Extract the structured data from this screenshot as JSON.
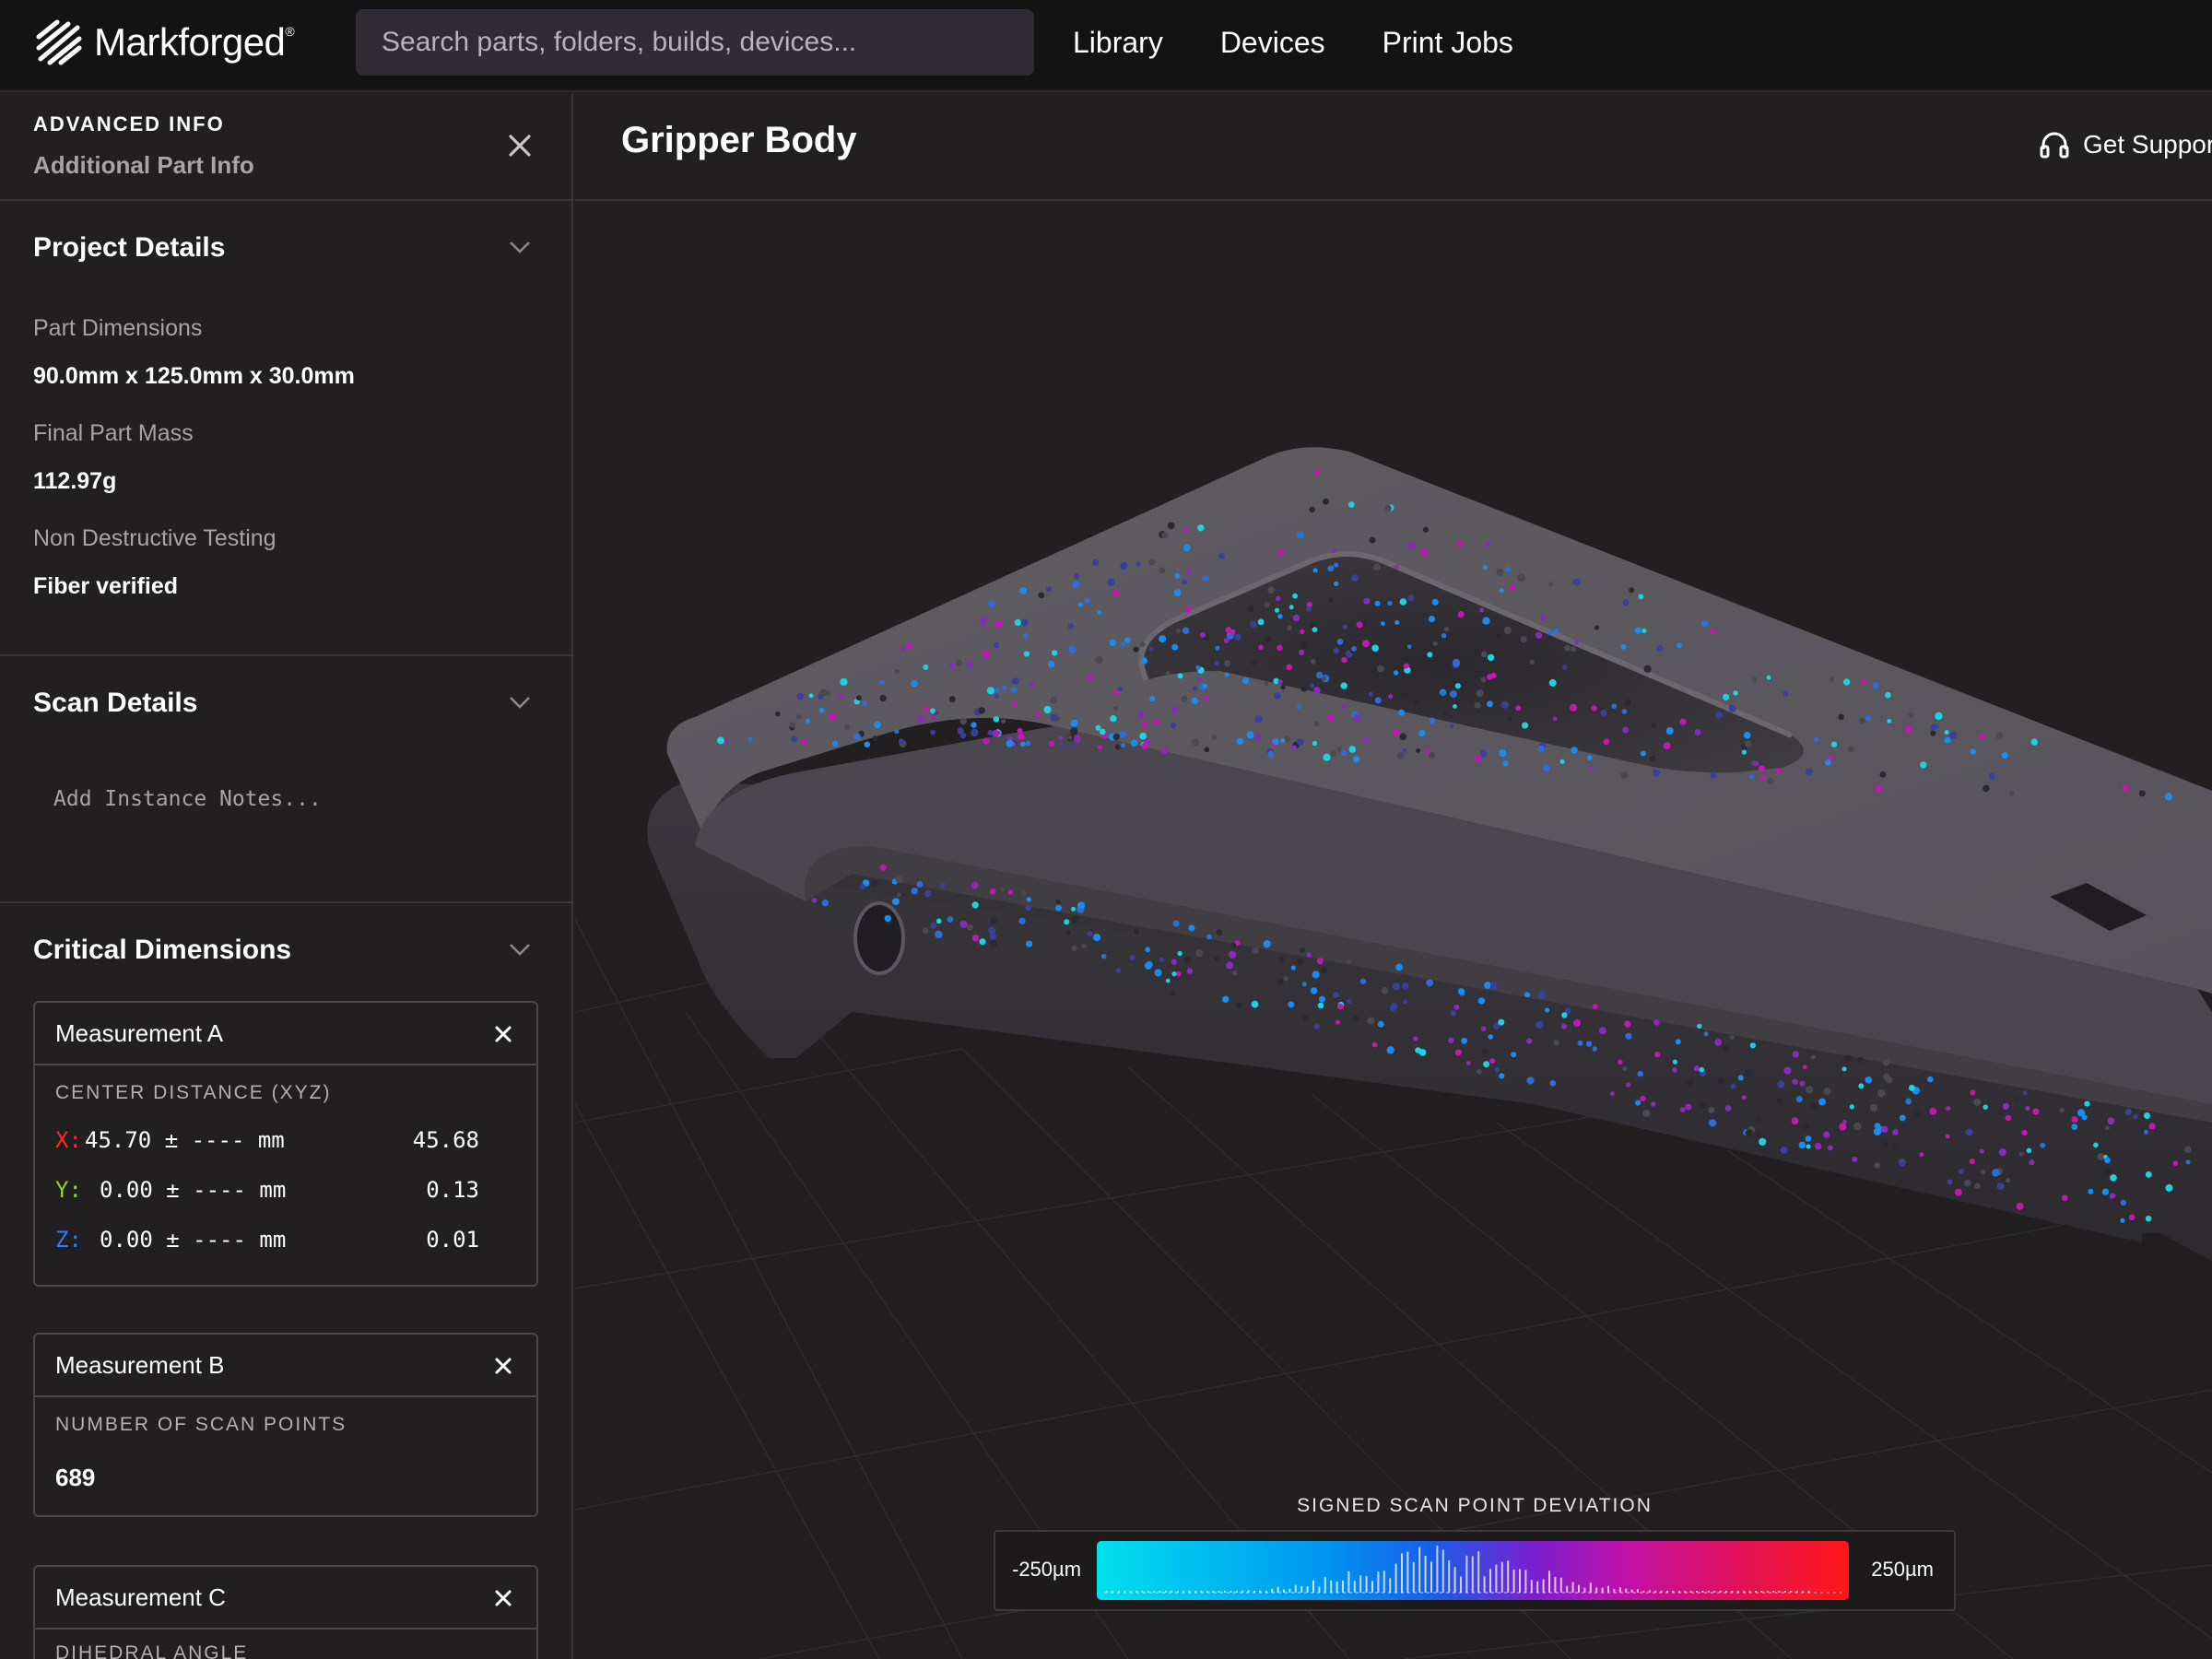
{
  "app": {
    "brand": "Markforged",
    "search_placeholder": "Search parts, folders, builds, devices...",
    "nav": [
      "Library",
      "Devices",
      "Print Jobs"
    ]
  },
  "panel": {
    "kicker": "ADVANCED INFO",
    "subtitle": "Additional Part Info",
    "project": {
      "title": "Project Details",
      "fields": [
        {
          "label": "Part Dimensions",
          "value": "90.0mm x 125.0mm x 30.0mm"
        },
        {
          "label": "Final Part Mass",
          "value": "112.97g"
        },
        {
          "label": "Non Destructive Testing",
          "value": "Fiber verified"
        }
      ]
    },
    "scan": {
      "title": "Scan Details",
      "notes_placeholder": "Add Instance Notes..."
    },
    "critical": {
      "title": "Critical Dimensions",
      "a": {
        "title": "Measurement A",
        "caption": "CENTER DISTANCE (XYZ)",
        "rows": [
          {
            "axis": "X:",
            "nominal": "45.70",
            "tol": "± ----",
            "unit": "mm",
            "actual": "45.68",
            "color": "#ff2a2a"
          },
          {
            "axis": "Y:",
            "nominal": " 0.00",
            "tol": "± ----",
            "unit": "mm",
            "actual": "0.13",
            "color": "#8fd42a"
          },
          {
            "axis": "Z:",
            "nominal": " 0.00",
            "tol": "± ----",
            "unit": "mm",
            "actual": "0.01",
            "color": "#2a7cff"
          }
        ]
      },
      "b": {
        "title": "Measurement B",
        "caption": "NUMBER OF SCAN POINTS",
        "value": "689"
      },
      "c": {
        "title": "Measurement C",
        "caption": "DIHEDRAL ANGLE"
      }
    }
  },
  "main": {
    "part_title": "Gripper Body",
    "support_label": "Get Support",
    "legend": {
      "title": "SIGNED SCAN POINT DEVIATION",
      "min": "-250µm",
      "max": "250µm"
    }
  }
}
